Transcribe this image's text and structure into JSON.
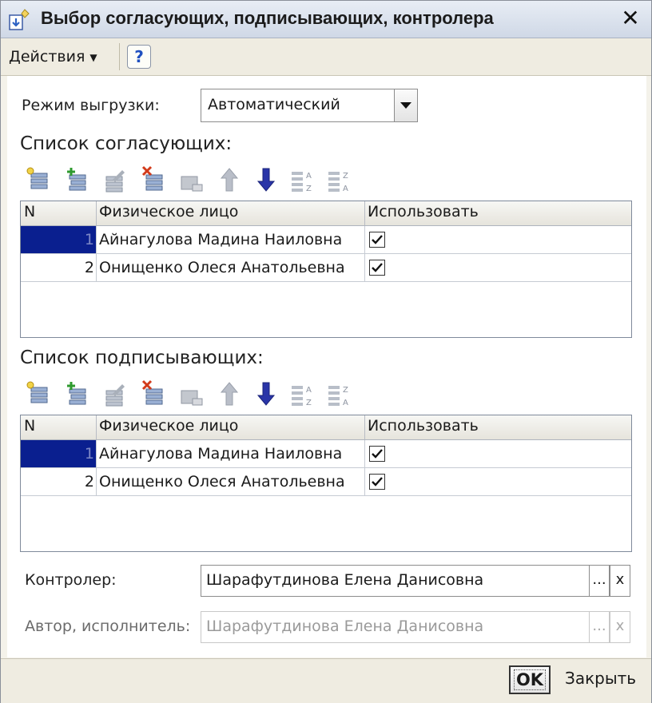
{
  "window": {
    "title": "Выбор согласующих, подписывающих, контролера",
    "title_icon": "document-select-icon",
    "close_icon": "close-icon"
  },
  "command_bar": {
    "actions_label": "Действия",
    "help_label": "?"
  },
  "export_mode": {
    "label": "Режим выгрузки:",
    "value": "Автоматический"
  },
  "approvers": {
    "title": "Список согласующих:",
    "columns": [
      "N",
      "Физическое лицо",
      "Использовать"
    ],
    "rows": [
      {
        "n": "1",
        "person": "Айнагулова Мадина Наиловна",
        "use": true
      },
      {
        "n": "2",
        "person": "Онищенко Олеся Анатольевна",
        "use": true
      }
    ]
  },
  "signers": {
    "title": "Список подписывающих:",
    "columns": [
      "N",
      "Физическое лицо",
      "Использовать"
    ],
    "rows": [
      {
        "n": "1",
        "person": "Айнагулова Мадина Наиловна",
        "use": true
      },
      {
        "n": "2",
        "person": "Онищенко Олеся Анатольевна",
        "use": true
      }
    ]
  },
  "controller": {
    "label": "Контролер:",
    "value": "Шарафутдинова Елена Данисовна",
    "select_label": "...",
    "clear_label": "x"
  },
  "author": {
    "label": "Автор, исполнитель:",
    "value": "Шарафутдинова Елена Данисовна",
    "select_label": "...",
    "clear_label": "x"
  },
  "footer": {
    "ok_label": "OK",
    "close_label": "Закрыть"
  },
  "colors": {
    "selected_cell": "#0a1f8f",
    "add_green": "#2e9a2e",
    "delete_red": "#d23a1a",
    "move_down_blue": "#2a35a8"
  }
}
